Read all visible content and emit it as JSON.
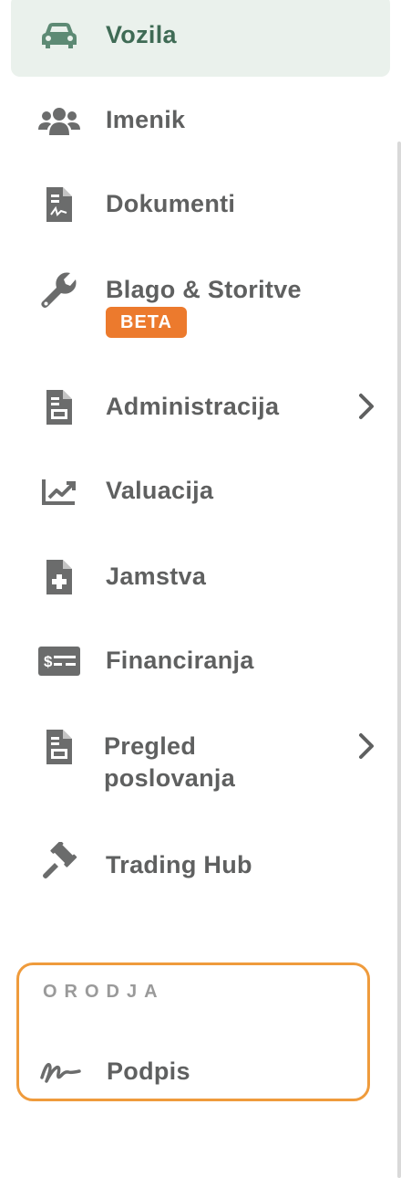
{
  "nav": {
    "items": [
      {
        "label": "Vozila",
        "icon": "car-icon",
        "active": true
      },
      {
        "label": "Imenik",
        "icon": "users-icon"
      },
      {
        "label": "Dokumenti",
        "icon": "document-signature-icon"
      },
      {
        "label": "Blago & Storitve",
        "icon": "wrench-icon",
        "badge": "BETA"
      },
      {
        "label": "Administracija",
        "icon": "file-lines-icon",
        "has_submenu": true
      },
      {
        "label": "Valuacija",
        "icon": "chart-line-icon"
      },
      {
        "label": "Jamstva",
        "icon": "file-plus-icon"
      },
      {
        "label": "Financiranja",
        "icon": "money-check-icon"
      },
      {
        "label": "Pregled poslovanja",
        "icon": "file-lines-icon",
        "has_submenu": true
      },
      {
        "label": "Trading Hub",
        "icon": "gavel-icon"
      }
    ]
  },
  "tools": {
    "heading": "ORODJA",
    "items": [
      {
        "label": "Podpis",
        "icon": "signature-icon"
      }
    ]
  },
  "colors": {
    "active_bg": "#eaf1ec",
    "active_text": "#3f6b55",
    "text": "#5f6060",
    "icon": "#6b6c6c",
    "badge": "#ec7a2d",
    "tools_border": "#ef9b3c"
  }
}
